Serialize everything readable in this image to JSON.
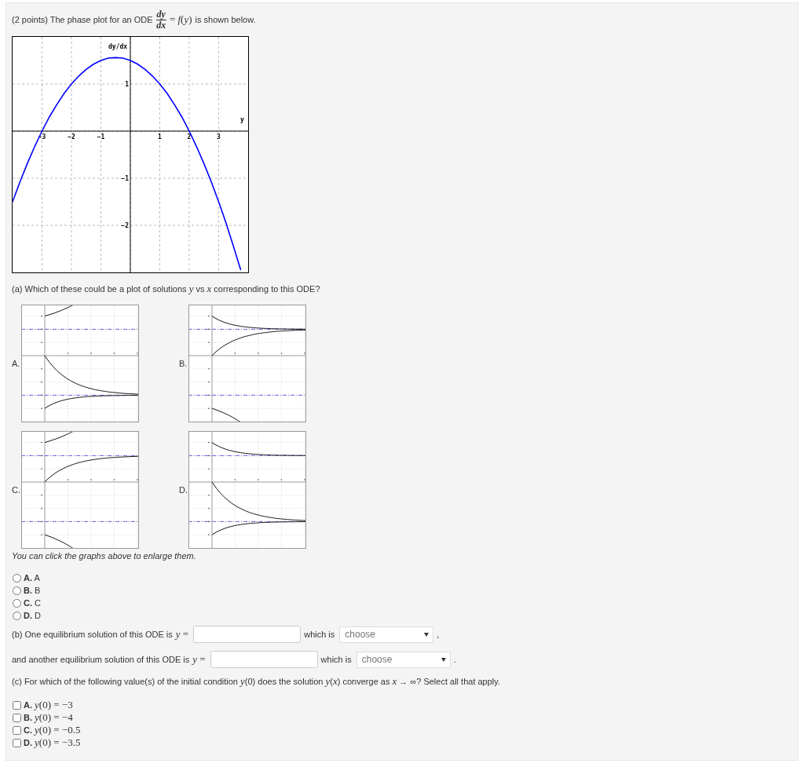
{
  "intro": {
    "text": "(2 points) The phase plot for an ODE",
    "numerator": "dy",
    "denominator": "dx",
    "equation": "= *f*(*y*)",
    "text_after": "is shown below."
  },
  "phase_plot": {
    "chart_data": {
      "type": "line",
      "xlabel": "y",
      "ylabel": "dy/dx",
      "x": [
        -4,
        -3.75,
        -3.5,
        -3.25,
        -3,
        -2.75,
        -2.5,
        -2.25,
        -2,
        -1.75,
        -1.5,
        -1.25,
        -1,
        -0.75,
        -0.5,
        -0.25,
        0,
        0.25,
        0.5,
        0.75,
        1,
        1.25,
        1.5,
        1.75,
        2,
        2.25,
        2.5,
        2.75,
        3,
        3.25,
        3.5,
        3.75
      ],
      "series": [
        {
          "color": "#0000ff",
          "values": [
            -1.5,
            -1.08,
            -0.69,
            -0.33,
            0,
            0.3,
            0.56,
            0.8,
            1,
            1.17,
            1.31,
            1.42,
            1.5,
            1.55,
            1.56,
            1.55,
            1.5,
            1.42,
            1.31,
            1.17,
            1,
            0.8,
            0.56,
            0.3,
            0,
            -0.33,
            -0.69,
            -1.08,
            -1.5,
            -1.95,
            -2.44,
            -2.95
          ]
        }
      ],
      "xlim": [
        -4,
        4
      ],
      "ylim": [
        -3,
        2
      ],
      "xticks": [
        -3,
        -2,
        -1,
        1,
        2,
        3
      ],
      "yticks": [
        -2,
        -1,
        1
      ],
      "grid": true
    }
  },
  "part_a": {
    "question": "(a) Which of these could be a plot of solutions *y* vs *x* corresponding to this ODE?",
    "graphs": [
      {
        "label": "A.",
        "curves": [
          {
            "kind": "top-escape-up"
          },
          {
            "kind": "bottom-settle-from-above"
          },
          {
            "kind": "bottom-settle-from-below"
          }
        ]
      },
      {
        "label": "B.",
        "curves": [
          {
            "kind": "top-settle-from-above"
          },
          {
            "kind": "top-settle-from-below"
          },
          {
            "kind": "bottom-escape-down"
          }
        ]
      },
      {
        "label": "C.",
        "curves": [
          {
            "kind": "top-escape-up"
          },
          {
            "kind": "top-settle-from-below"
          },
          {
            "kind": "bottom-escape-down"
          }
        ]
      },
      {
        "label": "D.",
        "curves": [
          {
            "kind": "top-settle-from-above"
          },
          {
            "kind": "bottom-settle-from-above"
          },
          {
            "kind": "bottom-settle-from-below"
          }
        ]
      }
    ],
    "note": "You can click the graphs above to enlarge them.",
    "options": [
      {
        "letter": "A.",
        "text": "A",
        "selected": false
      },
      {
        "letter": "B.",
        "text": "B",
        "selected": false
      },
      {
        "letter": "C.",
        "text": "C",
        "selected": false
      },
      {
        "letter": "D.",
        "text": "D",
        "selected": false
      }
    ]
  },
  "part_b": {
    "rows": [
      {
        "text": "(b) One equilibrium solution of this ODE is",
        "math": "*y* =",
        "which_is": "which is",
        "dropdown": "choose",
        "punctuation": ","
      },
      {
        "text": "and another equilibrium solution of this ODE is",
        "math": "*y* =",
        "which_is": "which is",
        "dropdown": "choose",
        "punctuation": "."
      }
    ]
  },
  "part_c": {
    "question": "(c) For which of the following value(s) of the initial condition *y*(0) does the solution *y*(*x*) converge as *x* → ∞? Select all that apply.",
    "options": [
      {
        "letter": "A.",
        "text": "*y*(0) = −3",
        "checked": false
      },
      {
        "letter": "B.",
        "text": "*y*(0) = −4",
        "checked": false
      },
      {
        "letter": "C.",
        "text": "*y*(0) = −0.5",
        "checked": false
      },
      {
        "letter": "D.",
        "text": "*y*(0) = −3.5",
        "checked": false
      }
    ]
  }
}
